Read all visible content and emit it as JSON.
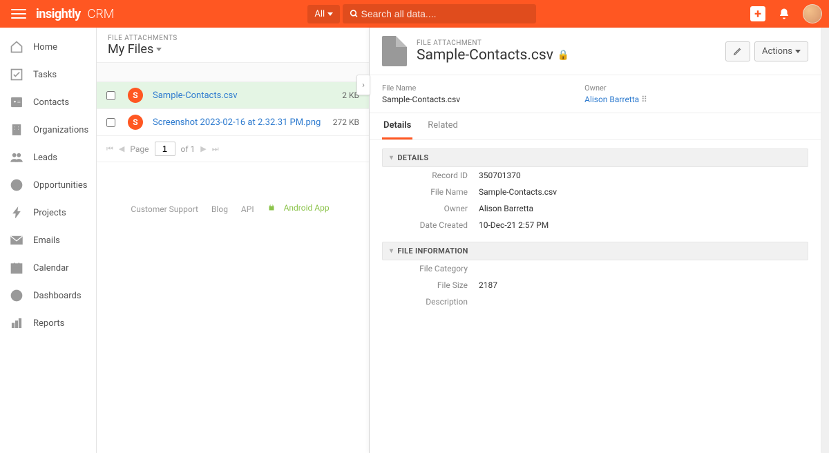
{
  "header": {
    "brand": "insightly",
    "app": "CRM",
    "filter": "All",
    "search_placeholder": "Search all data...."
  },
  "sidebar": {
    "items": [
      {
        "label": "Home"
      },
      {
        "label": "Tasks"
      },
      {
        "label": "Contacts"
      },
      {
        "label": "Organizations"
      },
      {
        "label": "Leads"
      },
      {
        "label": "Opportunities"
      },
      {
        "label": "Projects"
      },
      {
        "label": "Emails"
      },
      {
        "label": "Calendar"
      },
      {
        "label": "Dashboards"
      },
      {
        "label": "Reports"
      }
    ]
  },
  "list": {
    "eyebrow": "FILE ATTACHMENTS",
    "title": "My Files",
    "rows": [
      {
        "badge": "S",
        "name": "Sample-Contacts.csv",
        "size": "2 KB",
        "selected": true
      },
      {
        "badge": "S",
        "name": "Screenshot 2023-02-16 at 2.32.31 PM.png",
        "size": "272 KB",
        "selected": false
      }
    ],
    "pager": {
      "label_page": "Page",
      "current": "1",
      "of": "of 1"
    }
  },
  "footer": {
    "support": "Customer Support",
    "blog": "Blog",
    "api": "API",
    "android": "Android App"
  },
  "detail": {
    "eyebrow": "FILE ATTACHMENT",
    "title": "Sample-Contacts.csv",
    "actions_label": "Actions",
    "summary": {
      "file_name_label": "File Name",
      "file_name": "Sample-Contacts.csv",
      "owner_label": "Owner",
      "owner": "Alison Barretta"
    },
    "tabs": {
      "details": "Details",
      "related": "Related"
    },
    "section_details": "DETAILS",
    "section_fileinfo": "FILE INFORMATION",
    "fields": {
      "record_id_label": "Record ID",
      "record_id": "350701370",
      "file_name_label": "File Name",
      "file_name": "Sample-Contacts.csv",
      "owner_label": "Owner",
      "owner": "Alison Barretta",
      "date_created_label": "Date Created",
      "date_created": "10-Dec-21 2:57 PM",
      "file_category_label": "File Category",
      "file_category": "",
      "file_size_label": "File Size",
      "file_size": "2187",
      "description_label": "Description",
      "description": ""
    }
  }
}
